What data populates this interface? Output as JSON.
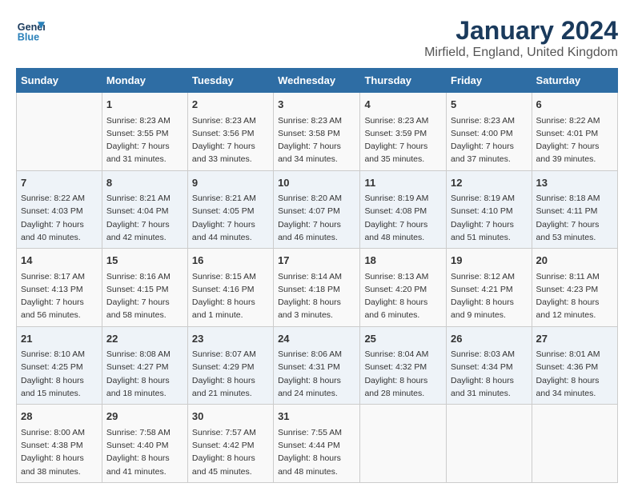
{
  "logo": {
    "general": "General",
    "blue": "Blue"
  },
  "header": {
    "month": "January 2024",
    "location": "Mirfield, England, United Kingdom"
  },
  "weekdays": [
    "Sunday",
    "Monday",
    "Tuesday",
    "Wednesday",
    "Thursday",
    "Friday",
    "Saturday"
  ],
  "weeks": [
    [
      {
        "day": null,
        "sunrise": null,
        "sunset": null,
        "daylight": null
      },
      {
        "day": "1",
        "sunrise": "Sunrise: 8:23 AM",
        "sunset": "Sunset: 3:55 PM",
        "daylight": "Daylight: 7 hours and 31 minutes."
      },
      {
        "day": "2",
        "sunrise": "Sunrise: 8:23 AM",
        "sunset": "Sunset: 3:56 PM",
        "daylight": "Daylight: 7 hours and 33 minutes."
      },
      {
        "day": "3",
        "sunrise": "Sunrise: 8:23 AM",
        "sunset": "Sunset: 3:58 PM",
        "daylight": "Daylight: 7 hours and 34 minutes."
      },
      {
        "day": "4",
        "sunrise": "Sunrise: 8:23 AM",
        "sunset": "Sunset: 3:59 PM",
        "daylight": "Daylight: 7 hours and 35 minutes."
      },
      {
        "day": "5",
        "sunrise": "Sunrise: 8:23 AM",
        "sunset": "Sunset: 4:00 PM",
        "daylight": "Daylight: 7 hours and 37 minutes."
      },
      {
        "day": "6",
        "sunrise": "Sunrise: 8:22 AM",
        "sunset": "Sunset: 4:01 PM",
        "daylight": "Daylight: 7 hours and 39 minutes."
      }
    ],
    [
      {
        "day": "7",
        "sunrise": "Sunrise: 8:22 AM",
        "sunset": "Sunset: 4:03 PM",
        "daylight": "Daylight: 7 hours and 40 minutes."
      },
      {
        "day": "8",
        "sunrise": "Sunrise: 8:21 AM",
        "sunset": "Sunset: 4:04 PM",
        "daylight": "Daylight: 7 hours and 42 minutes."
      },
      {
        "day": "9",
        "sunrise": "Sunrise: 8:21 AM",
        "sunset": "Sunset: 4:05 PM",
        "daylight": "Daylight: 7 hours and 44 minutes."
      },
      {
        "day": "10",
        "sunrise": "Sunrise: 8:20 AM",
        "sunset": "Sunset: 4:07 PM",
        "daylight": "Daylight: 7 hours and 46 minutes."
      },
      {
        "day": "11",
        "sunrise": "Sunrise: 8:19 AM",
        "sunset": "Sunset: 4:08 PM",
        "daylight": "Daylight: 7 hours and 48 minutes."
      },
      {
        "day": "12",
        "sunrise": "Sunrise: 8:19 AM",
        "sunset": "Sunset: 4:10 PM",
        "daylight": "Daylight: 7 hours and 51 minutes."
      },
      {
        "day": "13",
        "sunrise": "Sunrise: 8:18 AM",
        "sunset": "Sunset: 4:11 PM",
        "daylight": "Daylight: 7 hours and 53 minutes."
      }
    ],
    [
      {
        "day": "14",
        "sunrise": "Sunrise: 8:17 AM",
        "sunset": "Sunset: 4:13 PM",
        "daylight": "Daylight: 7 hours and 56 minutes."
      },
      {
        "day": "15",
        "sunrise": "Sunrise: 8:16 AM",
        "sunset": "Sunset: 4:15 PM",
        "daylight": "Daylight: 7 hours and 58 minutes."
      },
      {
        "day": "16",
        "sunrise": "Sunrise: 8:15 AM",
        "sunset": "Sunset: 4:16 PM",
        "daylight": "Daylight: 8 hours and 1 minute."
      },
      {
        "day": "17",
        "sunrise": "Sunrise: 8:14 AM",
        "sunset": "Sunset: 4:18 PM",
        "daylight": "Daylight: 8 hours and 3 minutes."
      },
      {
        "day": "18",
        "sunrise": "Sunrise: 8:13 AM",
        "sunset": "Sunset: 4:20 PM",
        "daylight": "Daylight: 8 hours and 6 minutes."
      },
      {
        "day": "19",
        "sunrise": "Sunrise: 8:12 AM",
        "sunset": "Sunset: 4:21 PM",
        "daylight": "Daylight: 8 hours and 9 minutes."
      },
      {
        "day": "20",
        "sunrise": "Sunrise: 8:11 AM",
        "sunset": "Sunset: 4:23 PM",
        "daylight": "Daylight: 8 hours and 12 minutes."
      }
    ],
    [
      {
        "day": "21",
        "sunrise": "Sunrise: 8:10 AM",
        "sunset": "Sunset: 4:25 PM",
        "daylight": "Daylight: 8 hours and 15 minutes."
      },
      {
        "day": "22",
        "sunrise": "Sunrise: 8:08 AM",
        "sunset": "Sunset: 4:27 PM",
        "daylight": "Daylight: 8 hours and 18 minutes."
      },
      {
        "day": "23",
        "sunrise": "Sunrise: 8:07 AM",
        "sunset": "Sunset: 4:29 PM",
        "daylight": "Daylight: 8 hours and 21 minutes."
      },
      {
        "day": "24",
        "sunrise": "Sunrise: 8:06 AM",
        "sunset": "Sunset: 4:31 PM",
        "daylight": "Daylight: 8 hours and 24 minutes."
      },
      {
        "day": "25",
        "sunrise": "Sunrise: 8:04 AM",
        "sunset": "Sunset: 4:32 PM",
        "daylight": "Daylight: 8 hours and 28 minutes."
      },
      {
        "day": "26",
        "sunrise": "Sunrise: 8:03 AM",
        "sunset": "Sunset: 4:34 PM",
        "daylight": "Daylight: 8 hours and 31 minutes."
      },
      {
        "day": "27",
        "sunrise": "Sunrise: 8:01 AM",
        "sunset": "Sunset: 4:36 PM",
        "daylight": "Daylight: 8 hours and 34 minutes."
      }
    ],
    [
      {
        "day": "28",
        "sunrise": "Sunrise: 8:00 AM",
        "sunset": "Sunset: 4:38 PM",
        "daylight": "Daylight: 8 hours and 38 minutes."
      },
      {
        "day": "29",
        "sunrise": "Sunrise: 7:58 AM",
        "sunset": "Sunset: 4:40 PM",
        "daylight": "Daylight: 8 hours and 41 minutes."
      },
      {
        "day": "30",
        "sunrise": "Sunrise: 7:57 AM",
        "sunset": "Sunset: 4:42 PM",
        "daylight": "Daylight: 8 hours and 45 minutes."
      },
      {
        "day": "31",
        "sunrise": "Sunrise: 7:55 AM",
        "sunset": "Sunset: 4:44 PM",
        "daylight": "Daylight: 8 hours and 48 minutes."
      },
      {
        "day": null,
        "sunrise": null,
        "sunset": null,
        "daylight": null
      },
      {
        "day": null,
        "sunrise": null,
        "sunset": null,
        "daylight": null
      },
      {
        "day": null,
        "sunrise": null,
        "sunset": null,
        "daylight": null
      }
    ]
  ]
}
